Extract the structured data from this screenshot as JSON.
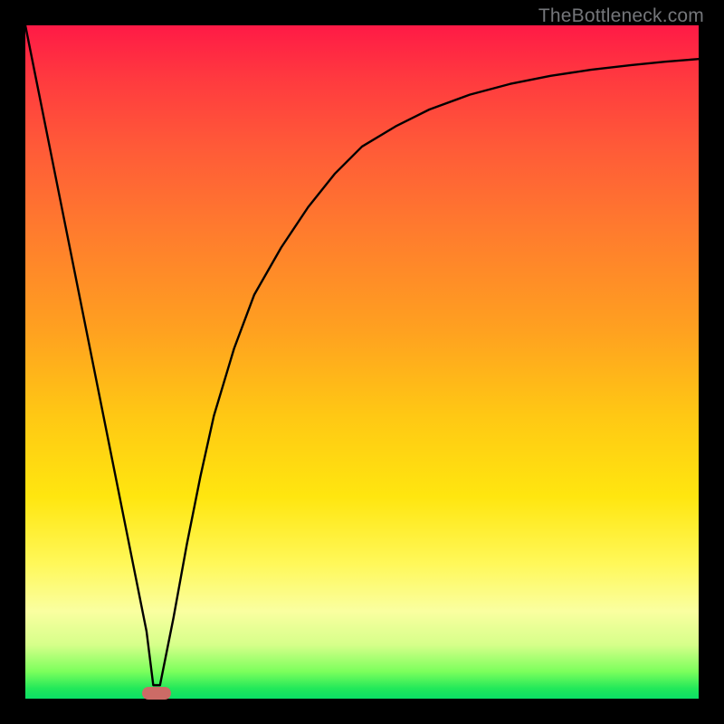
{
  "watermark": "TheBottleneck.com",
  "chart_data": {
    "type": "line",
    "title": "",
    "xlabel": "",
    "ylabel": "",
    "xlim": [
      0,
      100
    ],
    "ylim": [
      0,
      100
    ],
    "grid": false,
    "legend": false,
    "series": [
      {
        "name": "curve",
        "x": [
          0,
          2,
          4,
          6,
          8,
          10,
          12,
          14,
          16,
          18,
          19,
          20,
          22,
          24,
          26,
          28,
          31,
          34,
          38,
          42,
          46,
          50,
          55,
          60,
          66,
          72,
          78,
          84,
          90,
          95,
          100
        ],
        "y": [
          100,
          90,
          80,
          70,
          60,
          50,
          40,
          30,
          20,
          10,
          2,
          2,
          12,
          23,
          33,
          42,
          52,
          60,
          67,
          73,
          78,
          82,
          85,
          87.5,
          89.7,
          91.3,
          92.5,
          93.4,
          94.1,
          94.6,
          95
        ]
      }
    ],
    "background_gradient_stops": [
      {
        "pos": 0.0,
        "color": "#ff1a46"
      },
      {
        "pos": 0.3,
        "color": "#ff7a2e"
      },
      {
        "pos": 0.6,
        "color": "#ffd012"
      },
      {
        "pos": 0.85,
        "color": "#fbff90"
      },
      {
        "pos": 1.0,
        "color": "#0be066"
      }
    ],
    "marker": {
      "x": 19.5,
      "y": 0.8,
      "color": "#cc6b66"
    }
  },
  "plot_geometry": {
    "inner_left": 28,
    "inner_top": 28,
    "inner_width": 744,
    "inner_height": 744
  }
}
